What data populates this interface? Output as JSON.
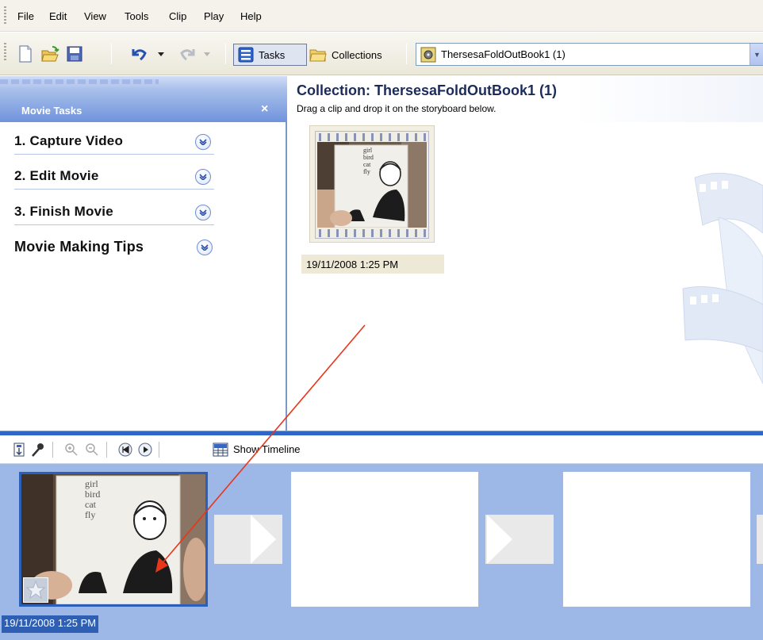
{
  "menu": {
    "items": [
      "File",
      "Edit",
      "View",
      "Tools",
      "Clip",
      "Play",
      "Help"
    ]
  },
  "toolbar": {
    "tasks_label": "Tasks",
    "collections_label": "Collections",
    "collection_selected": "ThersesaFoldOutBook1 (1)",
    "icons": [
      "new-project-icon",
      "open-project-icon",
      "save-project-icon",
      "undo-icon",
      "redo-icon"
    ]
  },
  "tasks": {
    "title": "Movie Tasks",
    "close": "×",
    "items": [
      {
        "label": "1. Capture Video"
      },
      {
        "label": "2. Edit Movie"
      },
      {
        "label": "3. Finish Movie"
      },
      {
        "label": "Movie Making Tips"
      }
    ]
  },
  "collection": {
    "title": "Collection: ThersesaFoldOutBook1 (1)",
    "subtitle": "Drag a clip and drop it on the storyboard below.",
    "clip": {
      "caption": "19/11/2008 1:25 PM",
      "words": [
        "girl",
        "bird",
        "cat",
        "fly"
      ]
    }
  },
  "storyboard_toolbar": {
    "show_timeline": "Show Timeline",
    "icons": [
      "narrate-icon",
      "audio-levels-icon",
      "zoom-in-icon",
      "zoom-out-icon",
      "rewind-icon",
      "play-icon",
      "timeline-icon"
    ]
  },
  "storyboard": {
    "clip_caption": "19/11/2008 1:25 PM",
    "words": [
      "girl",
      "bird",
      "cat",
      "fly"
    ]
  },
  "colors": {
    "accent_blue": "#2f67c8",
    "annotation_arrow": "#e8361b",
    "storyboard_bg": "#9db7e6"
  }
}
